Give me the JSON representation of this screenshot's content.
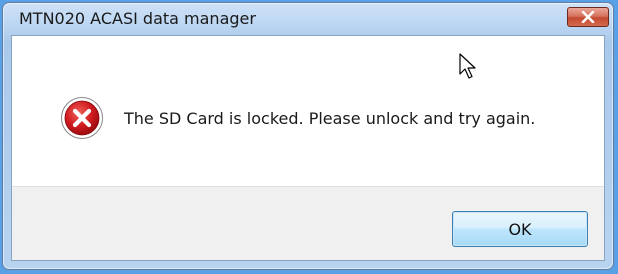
{
  "window": {
    "title": "MTN020 ACASI data manager",
    "close_icon": "close-icon"
  },
  "message": {
    "icon": "error-icon",
    "text": "The SD Card is locked.  Please unlock and try again."
  },
  "buttons": {
    "ok_label": "OK"
  },
  "colors": {
    "title_bar": "#bcd6f2",
    "close_button": "#c24b31",
    "error_icon": "#c9151e",
    "ok_button_border": "#3c7fb1",
    "button_area": "#f0f0f0"
  }
}
